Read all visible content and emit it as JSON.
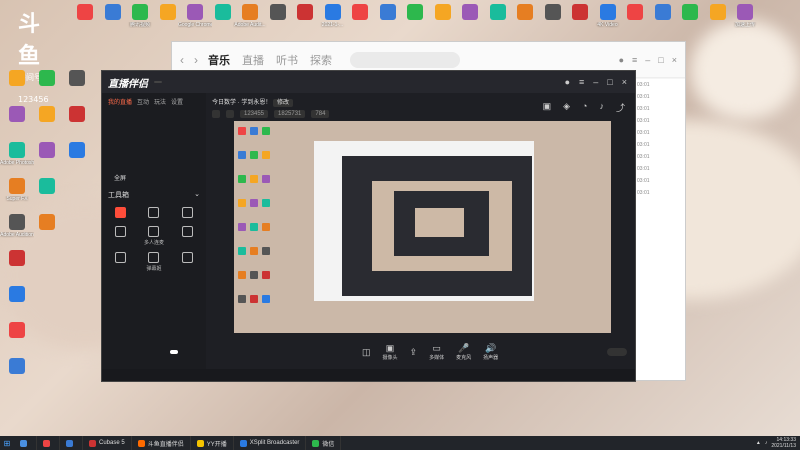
{
  "brand_logo": {
    "text": "斗鱼",
    "room_label": "房间号",
    "room_number": "123456"
  },
  "desktop_icons_top": [
    "",
    "",
    "腾讯视频",
    "",
    "Google Chrome",
    "",
    "Adobe Audit...",
    "",
    "",
    "2021-1-...",
    "",
    "",
    "",
    "",
    "",
    "",
    "",
    "",
    "",
    "4K Video",
    "",
    "",
    "",
    "",
    "加速上传"
  ],
  "desktop_icons_left": [
    "",
    "",
    "Adobe Photoshop...",
    "Super FX",
    "Adobe Audition",
    "",
    "",
    "",
    "",
    "",
    "",
    "",
    "",
    "",
    "",
    "",
    ""
  ],
  "music_window": {
    "tabs": [
      "音乐",
      "直播",
      "听书",
      "探索"
    ],
    "search_placeholder": "",
    "right_lines": [
      "03:01",
      "03:01",
      "03:01",
      "03:01",
      "03:01",
      "03:01",
      "03:01",
      "03:01",
      "03:01",
      "03:01"
    ]
  },
  "stream_app": {
    "brand": "直播伴侣",
    "version": "",
    "tabs": [
      "我的直播",
      "互动",
      "玩法",
      "设置"
    ],
    "scenes": [
      "",
      "",
      "",
      "",
      "",
      "",
      "",
      "",
      "",
      "",
      "全屏"
    ],
    "tools_title": "工具箱",
    "tools": [
      {
        "label": "",
        "hot": true
      },
      {
        "label": "",
        "hot": false
      },
      {
        "label": "",
        "hot": false
      },
      {
        "label": "",
        "hot": false
      },
      {
        "label": "多人连麦",
        "hot": false
      },
      {
        "label": "",
        "hot": false
      },
      {
        "label": "",
        "hot": false
      },
      {
        "label": "弹幕姬",
        "hot": false
      },
      {
        "label": "",
        "hot": false
      }
    ],
    "title_line": "今日数学 · 学到永恩！",
    "badge": "修改",
    "info_pills": [
      "",
      "",
      "123455",
      "1825731",
      "784"
    ],
    "bottom_buttons": [
      {
        "icon": "◫",
        "label": ""
      },
      {
        "icon": "▣",
        "label": "摄像头"
      },
      {
        "icon": "⇪",
        "label": ""
      },
      {
        "icon": "▭",
        "label": "多媒体"
      },
      {
        "icon": "🎤",
        "label": "麦克风"
      },
      {
        "icon": "🔊",
        "label": "扬声器"
      }
    ],
    "start_live": "",
    "tooltip": "",
    "status": [
      "",
      "",
      "",
      "",
      ""
    ]
  },
  "taskbar": {
    "items": [
      {
        "label": "",
        "color": "#4a90e2"
      },
      {
        "label": "",
        "color": "#e44"
      },
      {
        "label": "",
        "color": "#3a7bd5"
      },
      {
        "label": "Cubase 5",
        "color": "#c33"
      },
      {
        "label": "斗鱼直播伴侣",
        "color": "#ff6b00"
      },
      {
        "label": "YY开播",
        "color": "#f5c400"
      },
      {
        "label": "XSplit Broadcaster",
        "color": "#2a7ae2"
      },
      {
        "label": "微信",
        "color": "#2db84d"
      }
    ],
    "time": "14:13:33",
    "date": "2021/11/13"
  },
  "colors": {
    "accent": "#ff6b4a",
    "dark_bg": "#1e1f24"
  }
}
